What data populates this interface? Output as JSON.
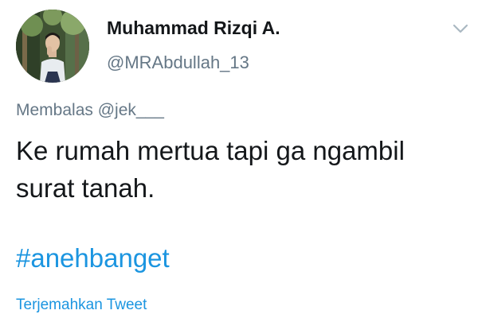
{
  "user": {
    "display_name": "Muhammad Rizqi A.",
    "handle": "@MRAbdullah_13"
  },
  "icons": {
    "avatar": "profile-photo",
    "menu": "chevron-down-icon"
  },
  "reply": {
    "prefix": "Membalas",
    "mention": "@jek___"
  },
  "tweet": {
    "text": "Ke rumah mertua tapi ga ngambil surat tanah.",
    "hashtag": "#anehbanget"
  },
  "actions": {
    "translate_label": "Terjemahkan Tweet"
  },
  "colors": {
    "link": "#1b95e0",
    "secondary_text": "#657786",
    "primary_text": "#14171a"
  }
}
